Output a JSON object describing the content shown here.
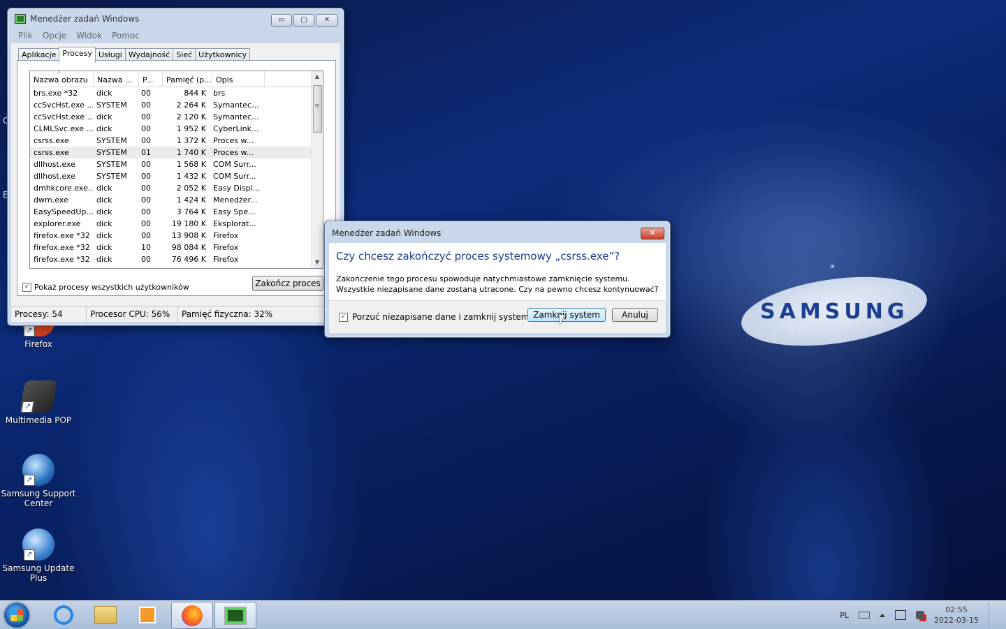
{
  "desktop": {
    "icons": [
      {
        "label": "Firefox"
      },
      {
        "label": "Multimedia POP"
      },
      {
        "label": "Samsung Support Center"
      },
      {
        "label": "Samsung Update Plus"
      }
    ],
    "logo_text": "SAMSUNG",
    "edge_letters": [
      "C",
      "E"
    ]
  },
  "task_manager": {
    "title": "Menedżer zadań Windows",
    "window_buttons": {
      "minimize": "▭",
      "maximize": "▢",
      "close": "✕"
    },
    "menu": [
      "Plik",
      "Opcje",
      "Widok",
      "Pomoc"
    ],
    "tabs": [
      "Aplikacje",
      "Procesy",
      "Usługi",
      "Wydajność",
      "Sieć",
      "Użytkownicy"
    ],
    "active_tab": "Procesy",
    "columns": [
      "Nazwa obrazu",
      "Nazwa ...",
      "P...",
      "Pamięć (p...",
      "Opis"
    ],
    "sort_arrow": "^",
    "rows": [
      [
        "brs.exe *32",
        "dick",
        "00",
        "844 K",
        "brs"
      ],
      [
        "ccSvcHst.exe ...",
        "SYSTEM",
        "00",
        "2 264 K",
        "Symantec..."
      ],
      [
        "ccSvcHst.exe ...",
        "dick",
        "00",
        "2 120 K",
        "Symantec..."
      ],
      [
        "CLMLSvc.exe ...",
        "dick",
        "00",
        "1 952 K",
        "CyberLink..."
      ],
      [
        "csrss.exe",
        "SYSTEM",
        "00",
        "1 372 K",
        "Proces w..."
      ],
      [
        "csrss.exe",
        "SYSTEM",
        "01",
        "1 740 K",
        "Proces w..."
      ],
      [
        "dllhost.exe",
        "SYSTEM",
        "00",
        "1 568 K",
        "COM Surr..."
      ],
      [
        "dllhost.exe",
        "SYSTEM",
        "00",
        "1 432 K",
        "COM Surr..."
      ],
      [
        "dmhkcore.exe...",
        "dick",
        "00",
        "2 052 K",
        "Easy Displ..."
      ],
      [
        "dwm.exe",
        "dick",
        "00",
        "1 424 K",
        "Menedżer..."
      ],
      [
        "EasySpeedUp...",
        "dick",
        "00",
        "3 764 K",
        "Easy Spe..."
      ],
      [
        "explorer.exe",
        "dick",
        "00",
        "19 180 K",
        "Eksplorat..."
      ],
      [
        "firefox.exe *32",
        "dick",
        "00",
        "13 908 K",
        "Firefox"
      ],
      [
        "firefox.exe *32",
        "dick",
        "10",
        "98 084 K",
        "Firefox"
      ],
      [
        "firefox.exe *32",
        "dick",
        "00",
        "76 496 K",
        "Firefox"
      ]
    ],
    "selected_row": 5,
    "scroll": {
      "up": "▲",
      "down": "▼",
      "grip": "≡"
    },
    "show_all_label": "Pokaż procesy wszystkich użytkowników",
    "show_all_checked": "✓",
    "end_process_label": "Zakończ proces",
    "status": {
      "processes": "Procesy: 54",
      "cpu": "Procesor CPU: 56%",
      "memory": "Pamięć fizyczna: 32%"
    }
  },
  "dialog": {
    "title": "Menedżer zadań Windows",
    "close_glyph": "✕",
    "heading": "Czy chcesz zakończyć proces systemowy „csrss.exe”?",
    "text": "Zakończenie tego procesu spowoduje natychmiastowe zamknięcie systemu. Wszystkie niezapisane dane zostaną utracone. Czy na pewno chcesz kontynuować?",
    "checkbox_label": "Porzuć niezapisane dane i zamknij system.",
    "checkbox_mark": "✓",
    "confirm_label": "Zamknij system",
    "cancel_label": "Anuluj"
  },
  "taskbar": {
    "language": "PL",
    "time": "02:55",
    "date": "2022-03-15"
  }
}
